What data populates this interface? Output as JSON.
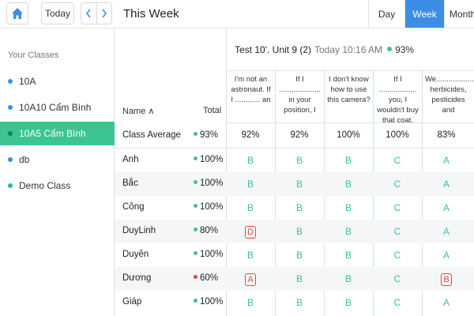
{
  "toolbar": {
    "today_label": "Today",
    "title": "This Week",
    "views": [
      "Day",
      "Week",
      "Month"
    ],
    "active_view": "Week",
    "accent": "#3d8de5"
  },
  "sidebar": {
    "heading": "Your Classes",
    "items": [
      {
        "label": "10A",
        "color": "#3d8de5"
      },
      {
        "label": "10A10 Cẩm Bình",
        "color": "#3d8de5"
      },
      {
        "label": "10A5 Cẩm Bình",
        "color": "#2f8f6b",
        "active": true
      },
      {
        "label": "db",
        "color": "#3d8de5"
      },
      {
        "label": "Demo Class",
        "color": "#28b6b1"
      }
    ]
  },
  "test": {
    "name": "Test 10'. Unit 9 (2)",
    "time": "Today 10:16 AM",
    "score": "93%"
  },
  "columns": {
    "name": "Name ∧",
    "total": "Total"
  },
  "questions": [
    "I'm not an astronaut. If I ............ an",
    "If I .................... in your position, I",
    "I don't know how to use this camera?",
    "If I .................. you, I wouldn't buy that coat.",
    "We................... herbicides, pesticides and"
  ],
  "average": {
    "label": "Class Average",
    "total": "93%",
    "values": [
      "92%",
      "92%",
      "100%",
      "100%",
      "83%"
    ]
  },
  "students": [
    {
      "name": "Anh",
      "total": "100%",
      "answers": [
        "B",
        "B",
        "B",
        "C",
        "A"
      ],
      "wrong": []
    },
    {
      "name": "Bắc",
      "total": "100%",
      "answers": [
        "B",
        "B",
        "B",
        "C",
        "A"
      ],
      "wrong": []
    },
    {
      "name": "Công",
      "total": "100%",
      "answers": [
        "B",
        "B",
        "B",
        "C",
        "A"
      ],
      "wrong": []
    },
    {
      "name": "DuyLinh",
      "total": "80%",
      "answers": [
        "D",
        "B",
        "B",
        "C",
        "A"
      ],
      "wrong": [
        0
      ]
    },
    {
      "name": "Duyên",
      "total": "100%",
      "answers": [
        "B",
        "B",
        "B",
        "C",
        "A"
      ],
      "wrong": []
    },
    {
      "name": "Dương",
      "total": "60%",
      "answers": [
        "A",
        "B",
        "B",
        "C",
        "B"
      ],
      "wrong": [
        0,
        4
      ]
    },
    {
      "name": "Giáp",
      "total": "100%",
      "answers": [
        "B",
        "B",
        "B",
        "C",
        "A"
      ],
      "wrong": []
    }
  ],
  "colors": {
    "correct": "#3cc491",
    "wrong": "#e04848"
  }
}
